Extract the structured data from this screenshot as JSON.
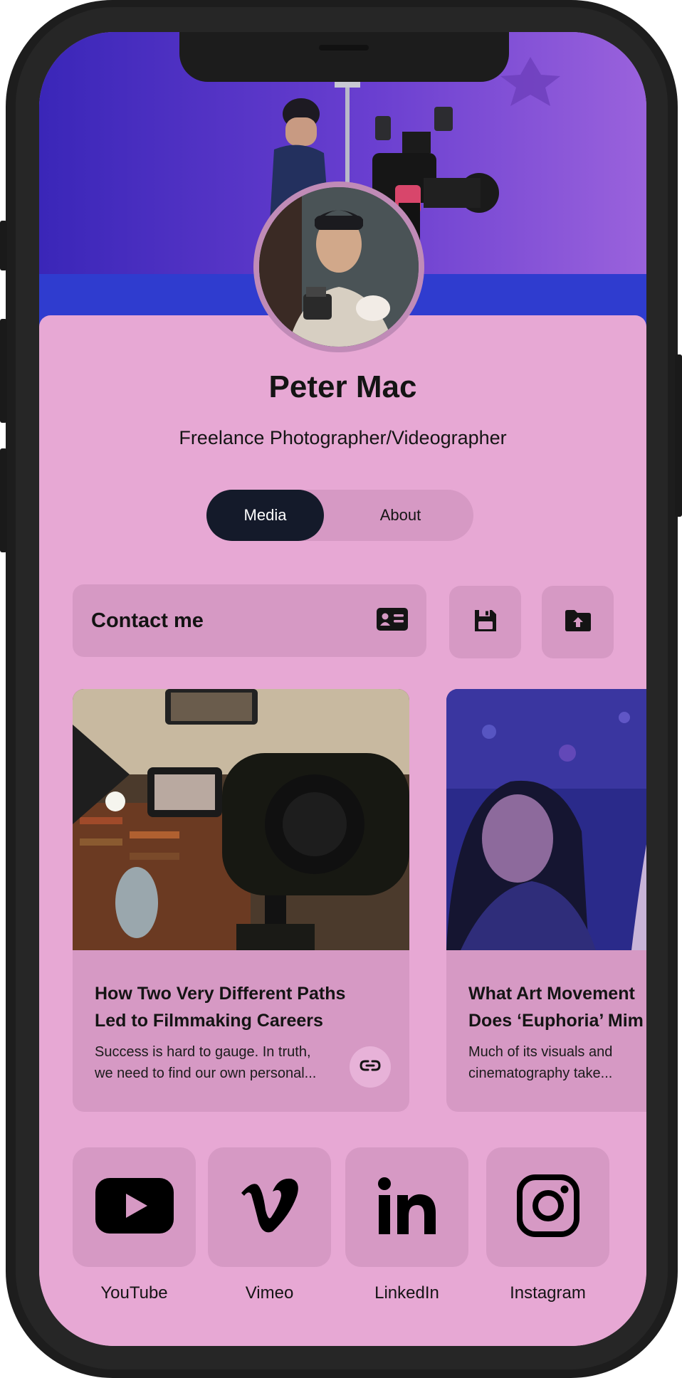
{
  "profile": {
    "name": "Peter Mac",
    "title": "Freelance Photographer/Videographer"
  },
  "tabs": [
    {
      "label": "Media",
      "active": true
    },
    {
      "label": "About",
      "active": false
    }
  ],
  "actions": {
    "contact_label": "Contact me",
    "contact_icon": "contact-card-icon",
    "save_icon": "floppy-disk-icon",
    "share_icon": "folder-upload-icon"
  },
  "articles": [
    {
      "title": "How Two Very Different Paths Led to Filmmaking Careers",
      "title_line1": "How Two Very Different Paths",
      "title_line2": "Led to Filmmaking Careers",
      "excerpt_line1": "Success is hard to gauge. In truth,",
      "excerpt_line2": "we need to find our own personal...",
      "link_icon": "link-icon"
    },
    {
      "title": "What Art Movement Does ‘Euphoria’ Mim",
      "title_line1": "What Art Movement",
      "title_line2": "Does ‘Euphoria’ Mim",
      "excerpt_line1": "Much of its visuals and",
      "excerpt_line2": "cinematography take..."
    }
  ],
  "socials": [
    {
      "label": "YouTube",
      "icon": "youtube-icon"
    },
    {
      "label": "Vimeo",
      "icon": "vimeo-icon"
    },
    {
      "label": "LinkedIn",
      "icon": "linkedin-icon"
    },
    {
      "label": "Instagram",
      "icon": "instagram-icon"
    }
  ],
  "colors": {
    "background": "#e7a8d4",
    "surface": "#d699c4",
    "active_tab": "#141a2a",
    "text": "#141414"
  }
}
